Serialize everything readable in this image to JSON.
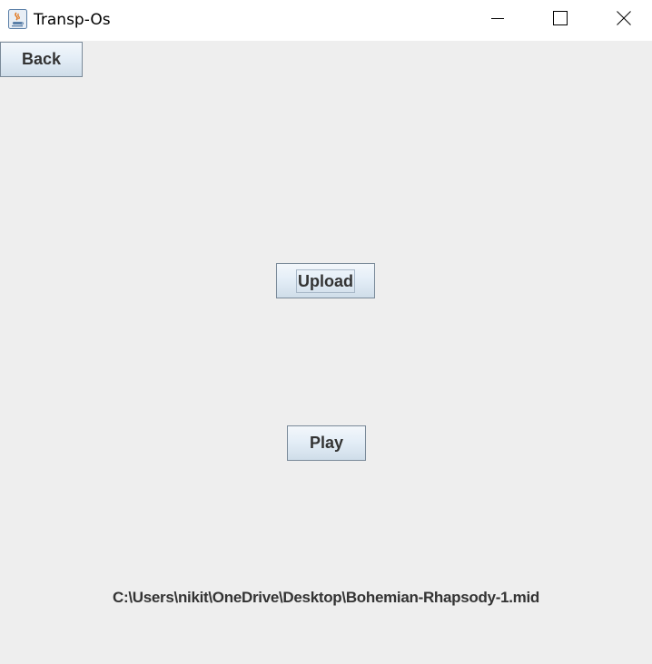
{
  "window": {
    "title": "Transp-Os",
    "app_icon": "java-coffee-cup-icon",
    "controls": {
      "minimize_icon": "minimize-icon",
      "maximize_icon": "maximize-icon",
      "close_icon": "close-icon"
    }
  },
  "buttons": {
    "back_label": "Back",
    "upload_label": "Upload",
    "play_label": "Play"
  },
  "file": {
    "path": "C:\\Users\\nikit\\OneDrive\\Desktop\\Bohemian-Rhapsody-1.mid"
  },
  "colors": {
    "background": "#eeeeee",
    "titlebar": "#ffffff",
    "button_border": "#7a8a99",
    "text": "#333333"
  }
}
